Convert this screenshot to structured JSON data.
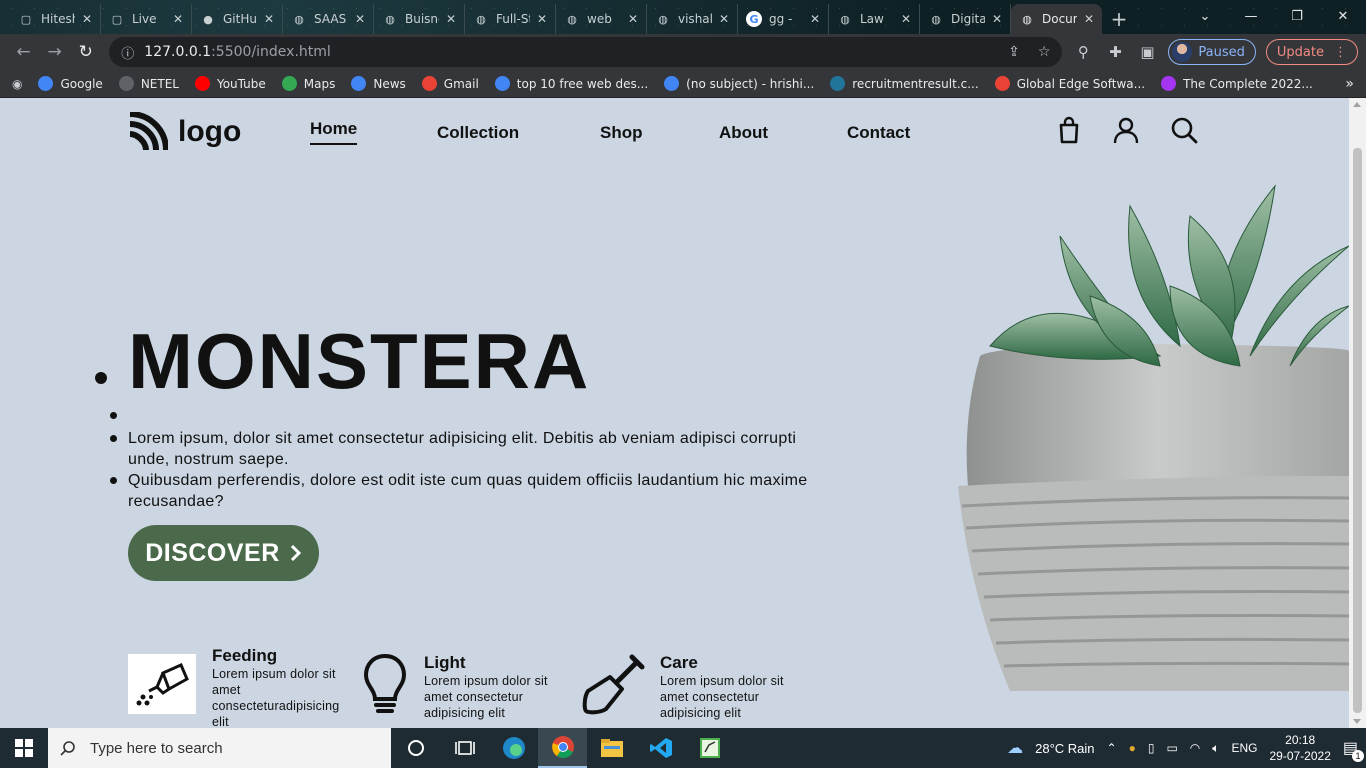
{
  "browser": {
    "tabs": [
      {
        "label": "Hitesh",
        "icon": "codepen-icon"
      },
      {
        "label": "Live",
        "icon": "codepen-icon"
      },
      {
        "label": "GitHub",
        "icon": "github-icon"
      },
      {
        "label": "SAAS",
        "icon": "globe-icon"
      },
      {
        "label": "Buisness",
        "icon": "globe-icon"
      },
      {
        "label": "Full-Stack",
        "icon": "site-icon"
      },
      {
        "label": "web",
        "icon": "globe-icon"
      },
      {
        "label": "vishal",
        "icon": "site-icon"
      },
      {
        "label": "gg -",
        "icon": "google-icon"
      },
      {
        "label": "Law",
        "icon": "globe-icon"
      },
      {
        "label": "Digital",
        "icon": "globe-icon"
      },
      {
        "label": "Document",
        "icon": "globe-icon",
        "active": true
      }
    ],
    "url_host": "127.0.0.1",
    "url_path": ":5500/index.html",
    "profile_label": "Paused",
    "update_label": "Update",
    "bookmarks": [
      {
        "label": "Google",
        "icon": "google-icon",
        "color": "#4285f4"
      },
      {
        "label": "NETEL",
        "icon": "globe-icon",
        "color": "#5f6368"
      },
      {
        "label": "YouTube",
        "icon": "youtube-icon",
        "color": "#ff0000"
      },
      {
        "label": "Maps",
        "icon": "maps-icon",
        "color": "#34a853"
      },
      {
        "label": "News",
        "icon": "news-icon",
        "color": "#4285f4"
      },
      {
        "label": "Gmail",
        "icon": "gmail-icon",
        "color": "#ea4335"
      },
      {
        "label": "top 10 free web des...",
        "icon": "google-icon",
        "color": "#4285f4"
      },
      {
        "label": "(no subject) - hrishi...",
        "icon": "google-icon",
        "color": "#4285f4"
      },
      {
        "label": "recruitmentresult.c...",
        "icon": "wordpress-icon",
        "color": "#21759b"
      },
      {
        "label": "Global Edge Softwa...",
        "icon": "gmail-icon",
        "color": "#ea4335"
      },
      {
        "label": "The Complete 2022...",
        "icon": "udemy-icon",
        "color": "#a435f0"
      }
    ]
  },
  "site": {
    "logo_text": "logo",
    "nav": [
      {
        "label": "Home",
        "active": true
      },
      {
        "label": "Collection"
      },
      {
        "label": "Shop"
      },
      {
        "label": "About"
      },
      {
        "label": "Contact"
      }
    ],
    "hero": {
      "title": "MONSTERA",
      "paragraphs": [
        "Lorem ipsum, dolor sit amet consectetur adipisicing elit. Debitis ab veniam adipisci corrupti unde, nostrum saepe.",
        "Quibusdam perferendis, dolore est odit iste cum quas quidem officiis laudantium hic maxime recusandae?"
      ],
      "cta_label": "DISCOVER",
      "cta_color": "#4a6a4b"
    },
    "features": [
      {
        "title": "Feeding",
        "text": "Lorem ipsum dolor sit amet consecteturadipisicing elit",
        "icon": "watering-can-icon"
      },
      {
        "title": "Light",
        "text": "Lorem ipsum dolor sit amet consectetur adipisicing elit",
        "icon": "lightbulb-icon"
      },
      {
        "title": "Care",
        "text": "Lorem ipsum dolor sit amet consectetur adipisicing elit",
        "icon": "shovel-icon"
      }
    ],
    "background": "#cbd6e2"
  },
  "taskbar": {
    "search_placeholder": "Type here to search",
    "weather": "28°C  Rain",
    "language": "ENG",
    "time": "20:18",
    "date": "29-07-2022",
    "notifications": "1"
  }
}
